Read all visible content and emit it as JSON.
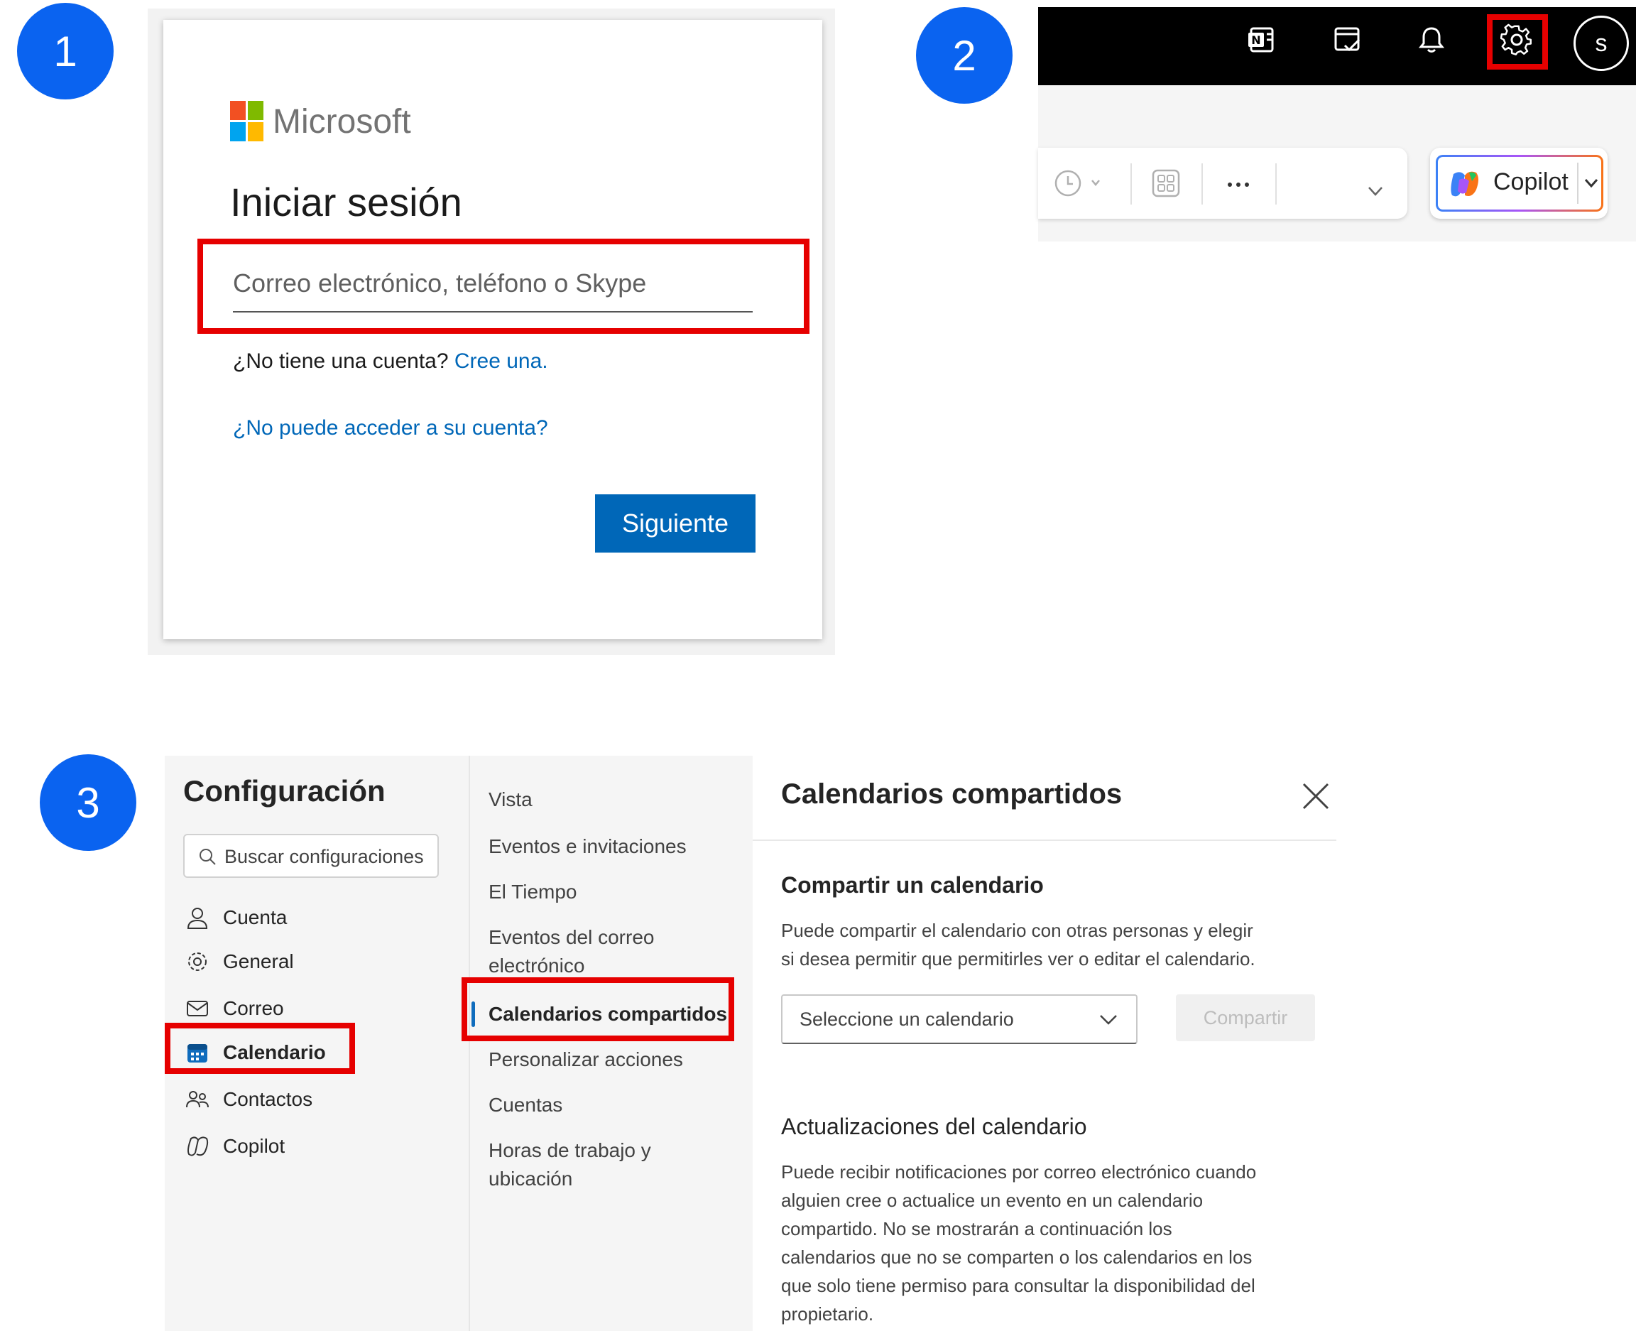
{
  "steps": [
    "1",
    "2",
    "3"
  ],
  "signin": {
    "brand": "Microsoft",
    "title": "Iniciar sesión",
    "email_placeholder": "Correo electrónico, teléfono o Skype",
    "no_account_text": "¿No tiene una cuenta?",
    "create_link": "Cree una.",
    "cant_access": "¿No puede acceder a su cuenta?",
    "next_button": "Siguiente",
    "logo_colors": [
      "#f25022",
      "#7fba00",
      "#00a4ef",
      "#ffb900"
    ]
  },
  "outlook_header": {
    "icons": [
      "onenote-icon",
      "todo-icon",
      "bell-icon",
      "gear-icon"
    ],
    "avatar_initial": "s",
    "copilot_label": "Copilot"
  },
  "settings": {
    "title": "Configuración",
    "search_placeholder": "Buscar configuraciones",
    "nav": [
      {
        "label": "Cuenta",
        "icon": "person-icon"
      },
      {
        "label": "General",
        "icon": "gear-icon"
      },
      {
        "label": "Correo",
        "icon": "mail-icon"
      },
      {
        "label": "Calendario",
        "icon": "calendar-icon"
      },
      {
        "label": "Contactos",
        "icon": "people-icon"
      },
      {
        "label": "Copilot",
        "icon": "copilot-icon"
      }
    ],
    "subnav": [
      "Vista",
      "Eventos e invitaciones",
      "El Tiempo",
      "Eventos del correo",
      "electrónico",
      "Calendarios compartidos",
      "Personalizar acciones",
      "Cuentas",
      "Horas de trabajo y",
      "ubicación"
    ],
    "panel": {
      "title": "Calendarios compartidos",
      "share_heading": "Compartir un calendario",
      "share_line1": "Puede compartir el calendario con otras personas y elegir",
      "share_line2": "si desea permitir que permitirles ver o editar el calendario.",
      "select_value": "Seleccione un calendario",
      "share_button": "Compartir",
      "updates_heading": "Actualizaciones del calendario",
      "updates_lines": [
        "Puede recibir notificaciones por correo electrónico cuando",
        "alguien cree o actualice un evento en un calendario",
        "compartido. No se mostrarán a continuación los",
        "calendarios que no se comparten o los calendarios en los",
        "que solo tiene permiso para consultar la disponibilidad del",
        "propietario."
      ]
    }
  },
  "colors": {
    "badge": "#0a63f0",
    "highlight": "#e60000",
    "ms_blue": "#0067b8"
  }
}
